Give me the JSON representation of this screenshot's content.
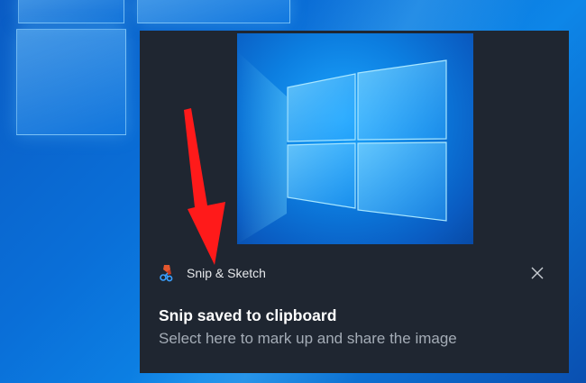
{
  "desktop": {
    "wallpaper": "windows-10-hero",
    "accent": "#0a6fd8"
  },
  "toast": {
    "app_icon": "snip-and-sketch-icon",
    "app_name": "Snip & Sketch",
    "close_icon": "close-icon",
    "title": "Snip saved to clipboard",
    "body": "Select here to mark up and share the image",
    "background": "#1f2631",
    "title_color": "#ffffff",
    "body_color": "#a4acb6"
  },
  "annotation": {
    "icon": "red-arrow-icon",
    "color": "#ff1a1a"
  }
}
